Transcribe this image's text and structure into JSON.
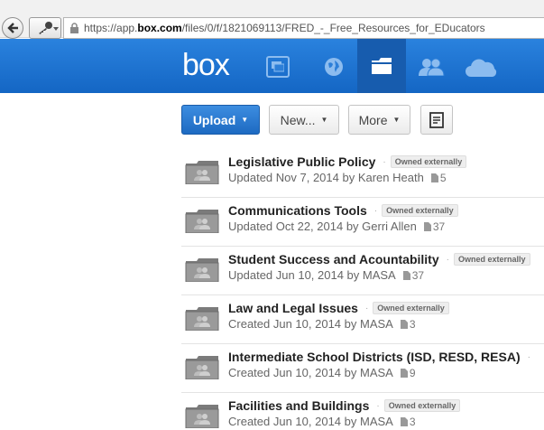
{
  "browser": {
    "url_prefix": "https://app.",
    "url_domain": "box.com",
    "url_path": "/files/0/f/1821069113/FRED_-_Free_Resources_for_EDucators"
  },
  "header": {
    "logo": "box",
    "icons": [
      "chat-icon",
      "globe-icon",
      "folder-icon",
      "people-icon",
      "cloud-icon"
    ]
  },
  "toolbar": {
    "upload_label": "Upload",
    "new_label": "New...",
    "more_label": "More"
  },
  "folders": [
    {
      "title": "Legislative Public Policy",
      "badge": "Owned externally",
      "meta": "Updated Nov 7, 2014 by Karen Heath",
      "count": "5"
    },
    {
      "title": "Communications Tools",
      "badge": "Owned externally",
      "meta": "Updated Oct 22, 2014 by Gerri Allen",
      "count": "37"
    },
    {
      "title": "Student Success and Acountability",
      "badge": "Owned externally",
      "meta": "Updated Jun 10, 2014 by MASA",
      "count": "37"
    },
    {
      "title": "Law and Legal Issues",
      "badge": "Owned externally",
      "meta": "Created Jun 10, 2014 by MASA",
      "count": "3"
    },
    {
      "title": "Intermediate School Districts (ISD, RESD, RESA)",
      "badge": "",
      "meta": "Created Jun 10, 2014 by MASA",
      "count": "9"
    },
    {
      "title": "Facilities and Buildings",
      "badge": "Owned externally",
      "meta": "Created Jun 10, 2014 by MASA",
      "count": "3"
    }
  ],
  "colors": {
    "brand_blue": "#1e74d3",
    "header_active": "#175cae"
  }
}
